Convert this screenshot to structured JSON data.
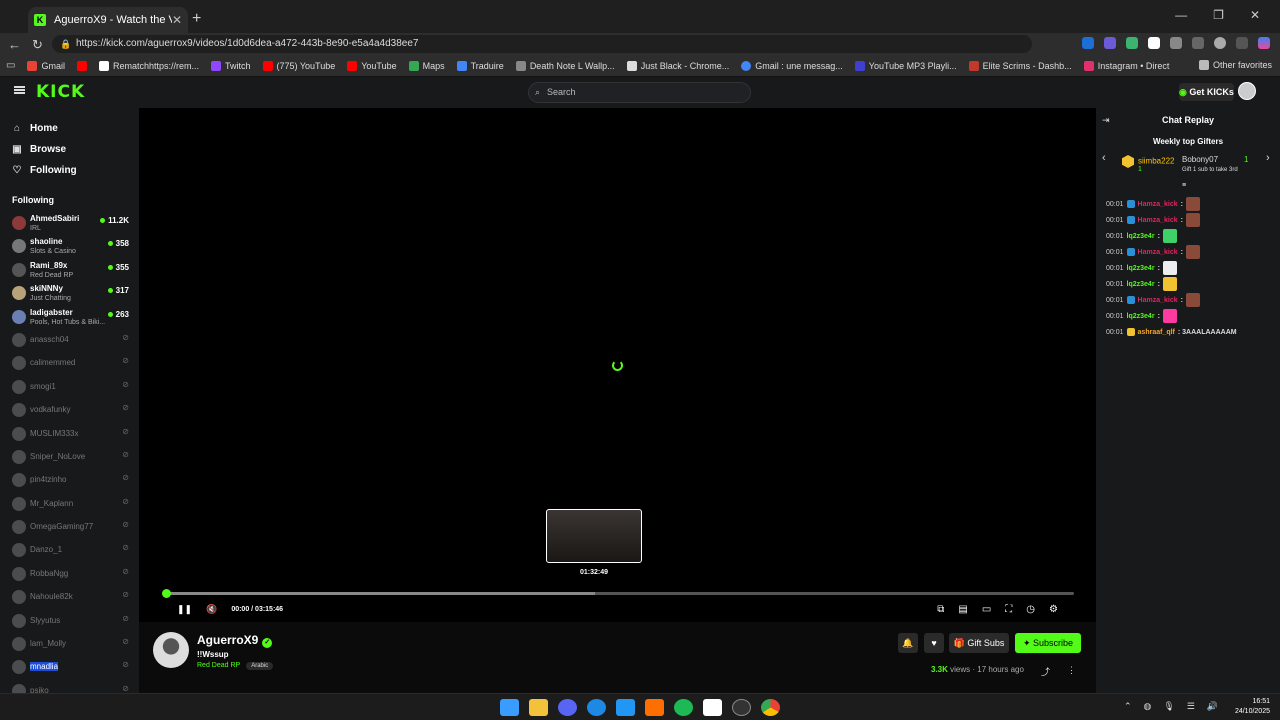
{
  "browser": {
    "tab_title": "AguerroX9 - Watch the VOD on Ki",
    "url": "https://kick.com/aguerrox9/videos/1d0d6dea-a472-443b-8e90-e5a4a4d38ee7",
    "bookmarks": [
      "Gmail",
      "Rematchhttps://rem...",
      "Twitch",
      "(775) YouTube",
      "YouTube",
      "Maps",
      "Traduire",
      "Death Note L Wallp...",
      "Just Black - Chrome...",
      "Gmail : une messag...",
      "YouTube MP3 Playli...",
      "Elite Scrims - Dashb...",
      "Instagram • Direct"
    ],
    "other_favorites": "Other favorites"
  },
  "site": {
    "search_placeholder": "Search",
    "get_kicks": "Get KICKs"
  },
  "sidebar": {
    "nav": [
      "Home",
      "Browse",
      "Following"
    ],
    "following_header": "Following",
    "live": [
      {
        "name": "AhmedSabiri",
        "category": "IRL",
        "viewers": "11.2K"
      },
      {
        "name": "shaoline",
        "category": "Slots & Casino",
        "viewers": "358"
      },
      {
        "name": "Rami_89x",
        "category": "Red Dead RP",
        "viewers": "355"
      },
      {
        "name": "skiNNNy",
        "category": "Just Chatting",
        "viewers": "317"
      },
      {
        "name": "ladigabster",
        "category": "Pools, Hot Tubs & Biki...",
        "viewers": "263"
      }
    ],
    "offline": [
      "anassch04",
      "calimemmed",
      "smogi1",
      "vodkafunky",
      "MUSLIM333x",
      "Sniper_NoLove",
      "pin4tzinho",
      "Mr_Kaplann",
      "OmegaGaming77",
      "Danzo_1",
      "RobbaNgg",
      "Nahoule82k",
      "Slyyutus",
      "lam_Molly",
      "mnadlia",
      "psiko"
    ]
  },
  "player": {
    "preview_time": "01:32:49",
    "current_time": "00:00",
    "duration": "03:15:46",
    "time_display": "00:00 / 03:15:46",
    "hover_fraction": 0.473
  },
  "stream": {
    "channel": "AguerroX9",
    "title": "!!Wssup",
    "category": "Red Dead RP",
    "language": "Arabic",
    "views": "3.3K",
    "views_label": " views",
    "age": "17 hours ago",
    "gift_subs": "Gift Subs",
    "subscribe": "Subscribe"
  },
  "chat": {
    "header": "Chat Replay",
    "gifters_header": "Weekly top Gifters",
    "gifters": [
      {
        "name": "siimba222",
        "count": "1"
      },
      {
        "name": "Bobony07",
        "count": "1",
        "tip": "Gift 1 sub to take 3rd"
      }
    ],
    "messages": [
      {
        "time": "00:01",
        "user": "Hamza_kick",
        "text": ":",
        "color": "#e0245e"
      },
      {
        "time": "00:01",
        "user": "Hamza_kick",
        "text": ":",
        "color": "#e0245e"
      },
      {
        "time": "00:01",
        "user": "lq2z3e4r",
        "text": ":",
        "color": "#53fc18"
      },
      {
        "time": "00:01",
        "user": "Hamza_kick",
        "text": ":",
        "color": "#e0245e"
      },
      {
        "time": "00:01",
        "user": "lq2z3e4r",
        "text": ":",
        "color": "#53fc18"
      },
      {
        "time": "00:01",
        "user": "lq2z3e4r",
        "text": ":",
        "color": "#53fc18"
      },
      {
        "time": "00:01",
        "user": "Hamza_kick",
        "text": ":",
        "color": "#e0245e"
      },
      {
        "time": "00:01",
        "user": "lq2z3e4r",
        "text": ":",
        "color": "#53fc18"
      },
      {
        "time": "00:01",
        "user": "ashraaf_qlf",
        "text": ": 3AAALAAAAAM",
        "color": "#f5a623"
      }
    ]
  },
  "taskbar": {
    "time": "16:51",
    "date": "24/10/2025"
  },
  "colors": {
    "accent": "#53fc18",
    "bg": "#0b0b0c",
    "panel": "#18191b"
  }
}
